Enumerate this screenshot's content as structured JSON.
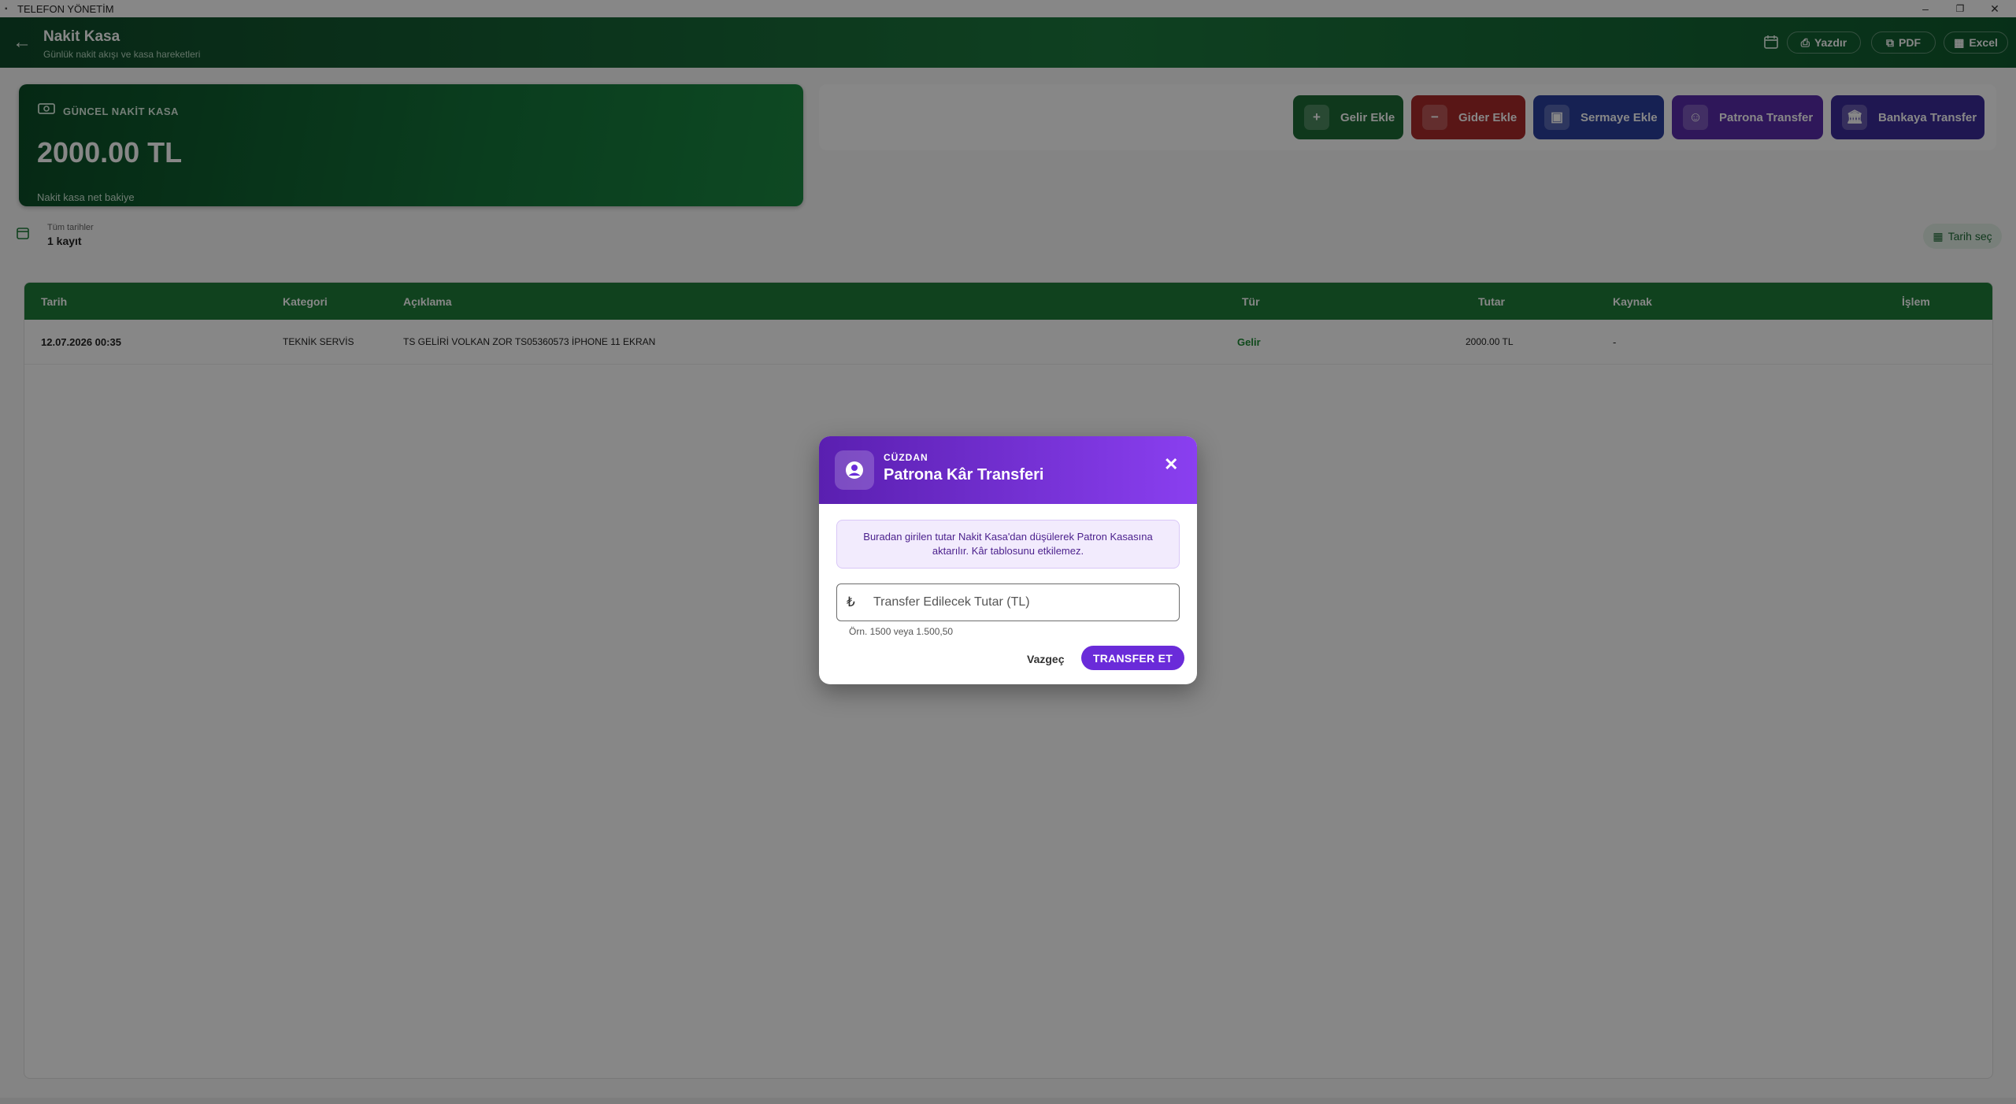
{
  "window": {
    "title": "TELEFON YÖNETİM"
  },
  "appbar": {
    "title": "Nakit Kasa",
    "subtitle": "Günlük nakit akışı ve kasa hareketleri",
    "print_label": "Yazdır",
    "pdf_label": "PDF",
    "excel_label": "Excel"
  },
  "balance_card": {
    "label": "GÜNCEL NAKİT KASA",
    "amount": "2000.00 TL",
    "caption": "Nakit kasa net bakiye"
  },
  "actions": {
    "gelir": "Gelir Ekle",
    "gider": "Gider Ekle",
    "sermaye": "Sermaye Ekle",
    "patron": "Patrona Transfer",
    "banka": "Bankaya Transfer"
  },
  "filter": {
    "range": "Tüm tarihler",
    "count": "1 kayıt",
    "date_button": "Tarih seç"
  },
  "table": {
    "headers": [
      "Tarih",
      "Kategori",
      "Açıklama",
      "Tür",
      "Tutar",
      "Kaynak",
      "İşlem"
    ],
    "rows": [
      [
        "12.07.2026 00:35",
        "TEKNİK SERVİS",
        "TS GELİRİ VOLKAN ZOR TS05360573 İPHONE 11 EKRAN",
        "Gelir",
        "2000.00 TL",
        "-",
        ""
      ]
    ]
  },
  "dialog": {
    "kicker": "CÜZDAN",
    "title": "Patrona Kâr Transferi",
    "info": "Buradan girilen tutar Nakit Kasa'dan düşülerek Patron Kasasına aktarılır. Kâr tablosunu etkilemez.",
    "currency_symbol": "₺",
    "amount_placeholder": "Transfer Edilecek Tutar (TL)",
    "amount_value": "",
    "hint": "Örn. 1500 veya 1.500,50",
    "cancel_label": "Vazgeç",
    "submit_label": "TRANSFER ET"
  },
  "colors": {
    "green_primary": "#1f7d3a",
    "purple_primary": "#6a2bd9",
    "gelir_text": "#1e8a34"
  }
}
